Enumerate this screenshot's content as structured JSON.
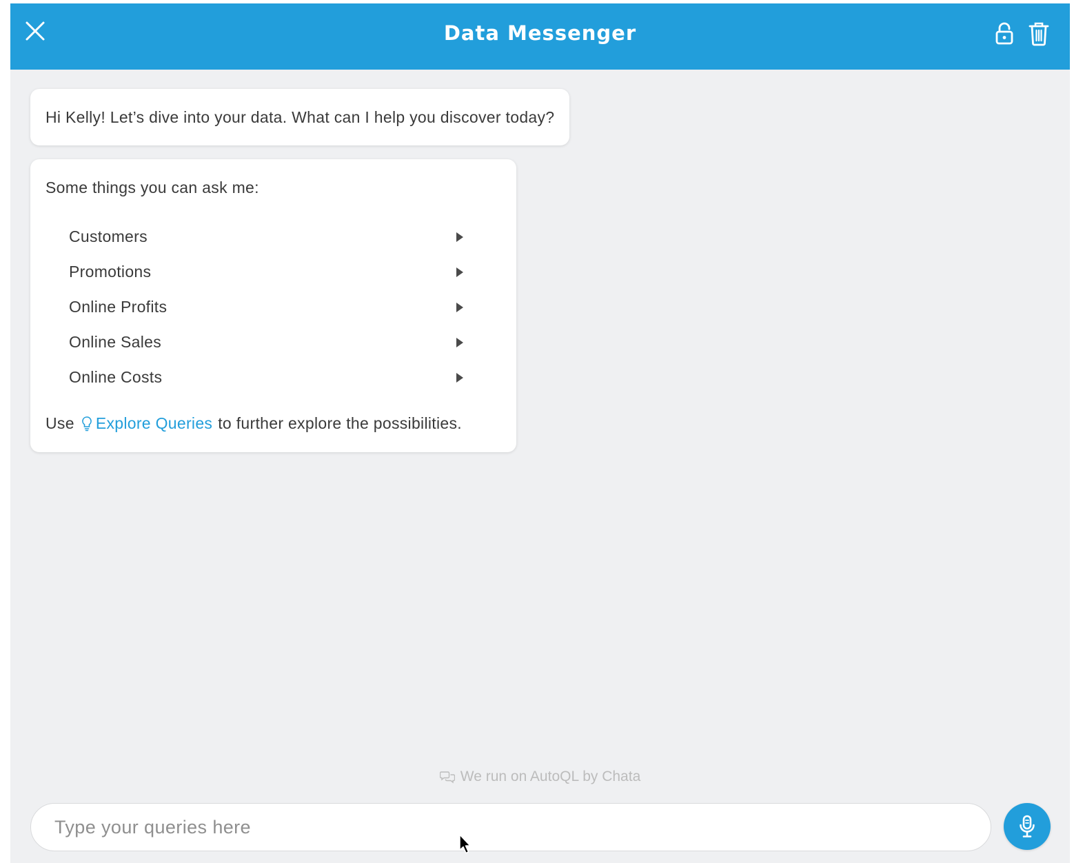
{
  "header": {
    "title": "Data Messenger",
    "close_icon": "close-icon",
    "lock_icon": "unlock-icon",
    "trash_icon": "trash-icon",
    "color": "#229edb"
  },
  "messages": {
    "greeting": "Hi Kelly! Let’s dive into your data. What can I help you discover today?",
    "suggestions": {
      "title": "Some things you can ask me:",
      "topics": [
        {
          "label": "Customers"
        },
        {
          "label": "Promotions"
        },
        {
          "label": "Online Profits"
        },
        {
          "label": "Online Sales"
        },
        {
          "label": "Online Costs"
        }
      ],
      "explore_prefix": "Use",
      "explore_link": "Explore Queries",
      "explore_suffix": "to further explore the possibilities."
    }
  },
  "footer": {
    "note": "We run on AutoQL by Chata"
  },
  "input": {
    "placeholder": "Type your queries here",
    "value": ""
  },
  "colors": {
    "accent": "#229edb",
    "background": "#eff0f2",
    "bubble": "#ffffff"
  }
}
